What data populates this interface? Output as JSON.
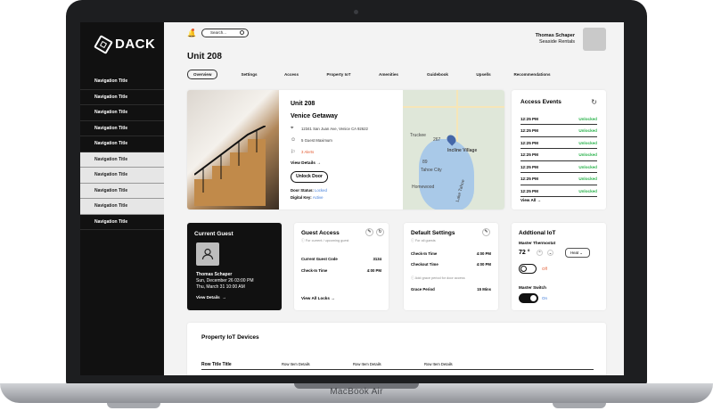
{
  "device_label": "MacBook Air",
  "brand": {
    "name": "DACK",
    "icon": "dack-logo-icon"
  },
  "sidebar": {
    "items": [
      {
        "label": "Navigation Title"
      },
      {
        "label": "Navigation Title"
      },
      {
        "label": "Navigation Title"
      },
      {
        "label": "Navigation Title"
      },
      {
        "label": "Navigation Title"
      },
      {
        "label": "Navigation Title"
      },
      {
        "label": "Navigation Title"
      },
      {
        "label": "Navigation Title"
      },
      {
        "label": "Navigation Title"
      },
      {
        "label": "Navigation Title"
      }
    ]
  },
  "header": {
    "search_label": "Search...",
    "user_name": "Thomas Schaper",
    "user_org": "Seaside Rentals"
  },
  "page": {
    "title": "Unit 208"
  },
  "tabs": [
    "Overview",
    "Settings",
    "Access",
    "Property IoT",
    "Amenities",
    "Guidebook",
    "Upsells",
    "Recommendations"
  ],
  "property": {
    "unit": "Unit 208",
    "name": "Venice Getaway",
    "address": "12341 San Juan Ave, Venice CA 92622",
    "guests": "5 Guest Maximum",
    "alerts": "3 Alerts",
    "view_details": "View Details",
    "unlock": "Unlock Door",
    "door_status_label": "Door Status:",
    "door_status": "Locked",
    "digital_key_label": "Digital Key:",
    "digital_key": "Active"
  },
  "map": {
    "labels": [
      "Truckee",
      "Incline Village",
      "Tahoe City",
      "Homewood",
      "Lake Tahoe",
      "267",
      "89",
      "28",
      "28"
    ]
  },
  "access_events": {
    "title": "Access Events",
    "rows": [
      {
        "time": "12:25 PM",
        "status": "Unlocked"
      },
      {
        "time": "12:25 PM",
        "status": "Unlocked"
      },
      {
        "time": "12:25 PM",
        "status": "Unlocked"
      },
      {
        "time": "12:25 PM",
        "status": "Unlocked"
      },
      {
        "time": "12:25 PM",
        "status": "Unlocked"
      },
      {
        "time": "12:25 PM",
        "status": "Unlocked"
      },
      {
        "time": "12:25 PM",
        "status": "Unlocked"
      }
    ],
    "view_all": "View All"
  },
  "current_guest": {
    "title": "Current Guest",
    "name": "Thomas Schaper",
    "checkin": "Sun, December 26 03:00 PM",
    "checkout": "Thu, March 31 10:00 AM",
    "view": "View Details"
  },
  "guest_access": {
    "title": "Guest Access",
    "note": "For current / upcoming guest",
    "code_label": "Current Guest Code",
    "code": "3134",
    "checkin_label": "Check-In Time",
    "checkin": "4:00 PM",
    "link": "View All Locks"
  },
  "default_settings": {
    "title": "Default Settings",
    "note": "For all guests",
    "checkin_label": "Check-In Time",
    "checkin": "4:00 PM",
    "checkout_label": "Checkout Time",
    "checkout": "4:00 PM",
    "grace_note": "Add grace period for door access",
    "grace_label": "Grace Period",
    "grace": "15 Mins"
  },
  "iot": {
    "title": "Addtional IoT",
    "thermostat_label": "Master Thermostat",
    "temp": "72 °",
    "mode": "Heat",
    "thermostat_state": "Off",
    "switch_label": "Master Switch",
    "switch_state": "On"
  },
  "devices": {
    "title": "Property IoT  Devices",
    "row": {
      "title": "Row Title Title",
      "cells": [
        "Row Item Details",
        "Row Item Details",
        "Row Item Details"
      ]
    }
  },
  "colors": {
    "accent_green": "#2bb24c",
    "alert_orange": "#e2572c",
    "link_blue": "#3d7ad8"
  }
}
